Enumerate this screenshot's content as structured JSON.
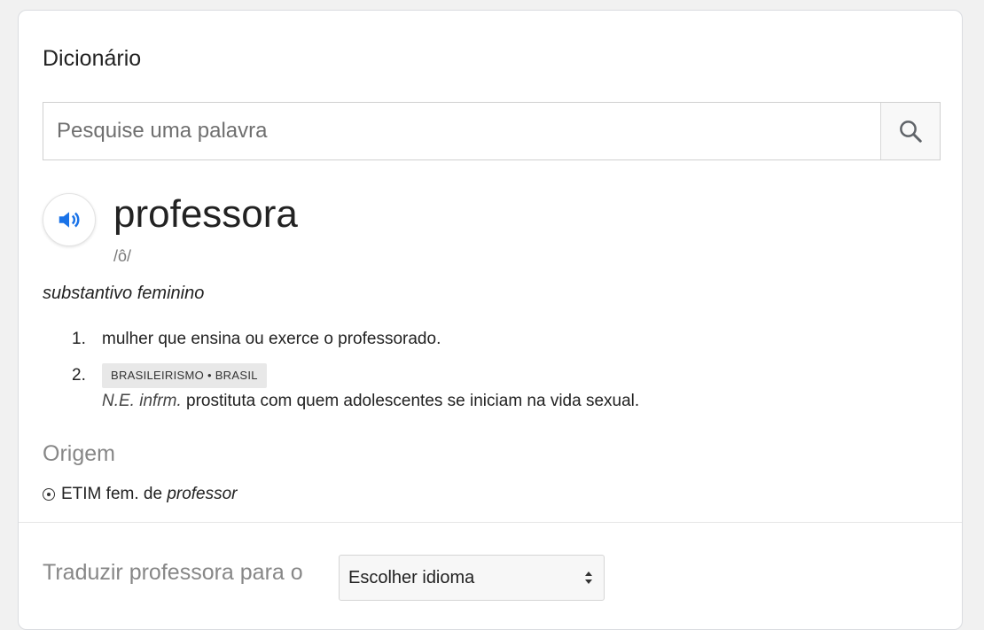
{
  "dictionary": {
    "title": "Dicionário",
    "search_placeholder": "Pesquise uma palavra",
    "search_icon": "search-icon",
    "speaker_icon": "speaker-icon",
    "word": "professora",
    "phonetic": "/ô/",
    "part_of_speech": "substantivo feminino",
    "definitions": [
      {
        "number": "1.",
        "text": "mulher que ensina ou exerce o professorado."
      },
      {
        "number": "2.",
        "tag": "BRASILEIRISMO • BRASIL",
        "label": "N.E. infrm.",
        "text": "prostituta com quem adolescentes se iniciam na vida sexual."
      }
    ],
    "origin_heading": "Origem",
    "origin": {
      "prefix": "ETIM fem. de ",
      "word": "professor"
    }
  },
  "translate": {
    "label": "Traduzir professora para o",
    "select_value": "Escolher idioma"
  },
  "colors": {
    "accent": "#1a73e8",
    "muted": "#878787",
    "tag_bg": "#e8e8e8"
  }
}
